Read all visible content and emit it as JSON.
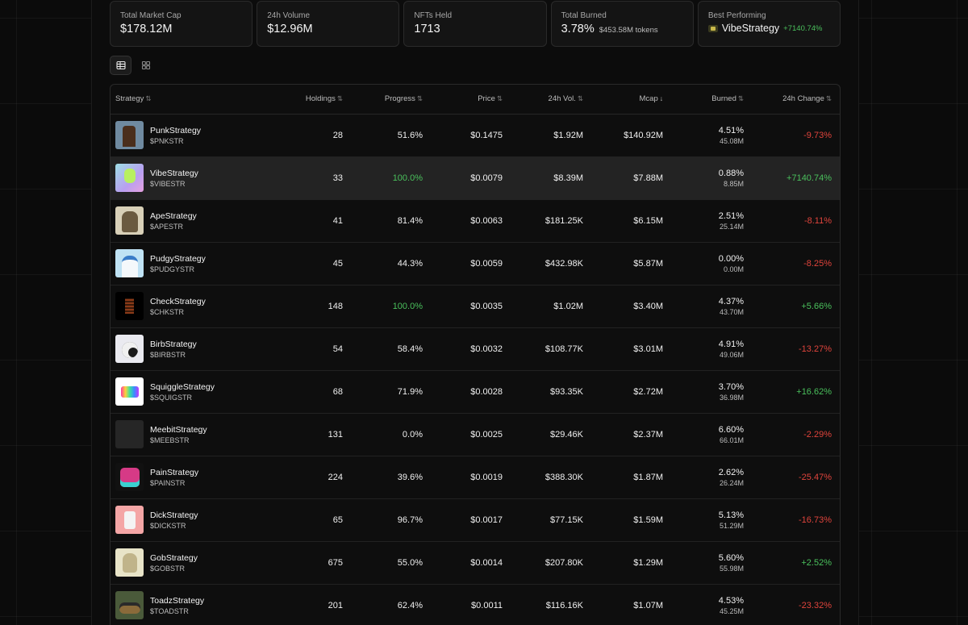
{
  "stats": [
    {
      "label": "Total Market Cap",
      "value": "$178.12M"
    },
    {
      "label": "24h Volume",
      "value": "$12.96M"
    },
    {
      "label": "NFTs Held",
      "value": "1713"
    },
    {
      "label": "Total Burned",
      "value": "3.78%",
      "sub": "$453.58M tokens"
    },
    {
      "label": "Best Performing",
      "value": "VibeStrategy",
      "change": "+7140.74%"
    }
  ],
  "view_toggle": {
    "active": "table",
    "icons": [
      "table-icon",
      "grid-icon"
    ]
  },
  "table": {
    "headers": {
      "strategy": "Strategy",
      "holdings": "Holdings",
      "progress": "Progress",
      "price": "Price",
      "volume": "24h Vol.",
      "mcap": "Mcap",
      "burned": "Burned",
      "change": "24h Change"
    },
    "sort_icons": {
      "unsorted": "⇅",
      "descending": "↓"
    },
    "rows": [
      {
        "name": "PunkStrategy",
        "ticker": "$PNKSTR",
        "holdings": "28",
        "progress": "51.6%",
        "price": "$0.1475",
        "volume": "$1.92M",
        "mcap": "$140.92M",
        "burned_pct": "4.51%",
        "burned_tokens": "45.08M",
        "change": "-9.73%"
      },
      {
        "name": "VibeStrategy",
        "ticker": "$VIBESTR",
        "holdings": "33",
        "progress": "100.0%",
        "price": "$0.0079",
        "volume": "$8.39M",
        "mcap": "$7.88M",
        "burned_pct": "0.88%",
        "burned_tokens": "8.85M",
        "change": "+7140.74%"
      },
      {
        "name": "ApeStrategy",
        "ticker": "$APESTR",
        "holdings": "41",
        "progress": "81.4%",
        "price": "$0.0063",
        "volume": "$181.25K",
        "mcap": "$6.15M",
        "burned_pct": "2.51%",
        "burned_tokens": "25.14M",
        "change": "-8.11%"
      },
      {
        "name": "PudgyStrategy",
        "ticker": "$PUDGYSTR",
        "holdings": "45",
        "progress": "44.3%",
        "price": "$0.0059",
        "volume": "$432.98K",
        "mcap": "$5.87M",
        "burned_pct": "0.00%",
        "burned_tokens": "0.00M",
        "change": "-8.25%"
      },
      {
        "name": "CheckStrategy",
        "ticker": "$CHKSTR",
        "holdings": "148",
        "progress": "100.0%",
        "price": "$0.0035",
        "volume": "$1.02M",
        "mcap": "$3.40M",
        "burned_pct": "4.37%",
        "burned_tokens": "43.70M",
        "change": "+5.66%"
      },
      {
        "name": "BirbStrategy",
        "ticker": "$BIRBSTR",
        "holdings": "54",
        "progress": "58.4%",
        "price": "$0.0032",
        "volume": "$108.77K",
        "mcap": "$3.01M",
        "burned_pct": "4.91%",
        "burned_tokens": "49.06M",
        "change": "-13.27%"
      },
      {
        "name": "SquiggleStrategy",
        "ticker": "$SQUIGSTR",
        "holdings": "68",
        "progress": "71.9%",
        "price": "$0.0028",
        "volume": "$93.35K",
        "mcap": "$2.72M",
        "burned_pct": "3.70%",
        "burned_tokens": "36.98M",
        "change": "+16.62%"
      },
      {
        "name": "MeebitStrategy",
        "ticker": "$MEEBSTR",
        "holdings": "131",
        "progress": "0.0%",
        "price": "$0.0025",
        "volume": "$29.46K",
        "mcap": "$2.37M",
        "burned_pct": "6.60%",
        "burned_tokens": "66.01M",
        "change": "-2.29%"
      },
      {
        "name": "PainStrategy",
        "ticker": "$PAINSTR",
        "holdings": "224",
        "progress": "39.6%",
        "price": "$0.0019",
        "volume": "$388.30K",
        "mcap": "$1.87M",
        "burned_pct": "2.62%",
        "burned_tokens": "26.24M",
        "change": "-25.47%"
      },
      {
        "name": "DickStrategy",
        "ticker": "$DICKSTR",
        "holdings": "65",
        "progress": "96.7%",
        "price": "$0.0017",
        "volume": "$77.15K",
        "mcap": "$1.59M",
        "burned_pct": "5.13%",
        "burned_tokens": "51.29M",
        "change": "-16.73%"
      },
      {
        "name": "GobStrategy",
        "ticker": "$GOBSTR",
        "holdings": "675",
        "progress": "55.0%",
        "price": "$0.0014",
        "volume": "$207.80K",
        "mcap": "$1.29M",
        "burned_pct": "5.60%",
        "burned_tokens": "55.98M",
        "change": "+2.52%"
      },
      {
        "name": "ToadzStrategy",
        "ticker": "$TOADSTR",
        "holdings": "201",
        "progress": "62.4%",
        "price": "$0.0011",
        "volume": "$116.16K",
        "mcap": "$1.07M",
        "burned_pct": "4.53%",
        "burned_tokens": "45.25M",
        "change": "-23.32%"
      }
    ]
  },
  "colors": {
    "positive": "#4ac05c",
    "negative": "#e0443c",
    "row_highlight": "#232323"
  }
}
